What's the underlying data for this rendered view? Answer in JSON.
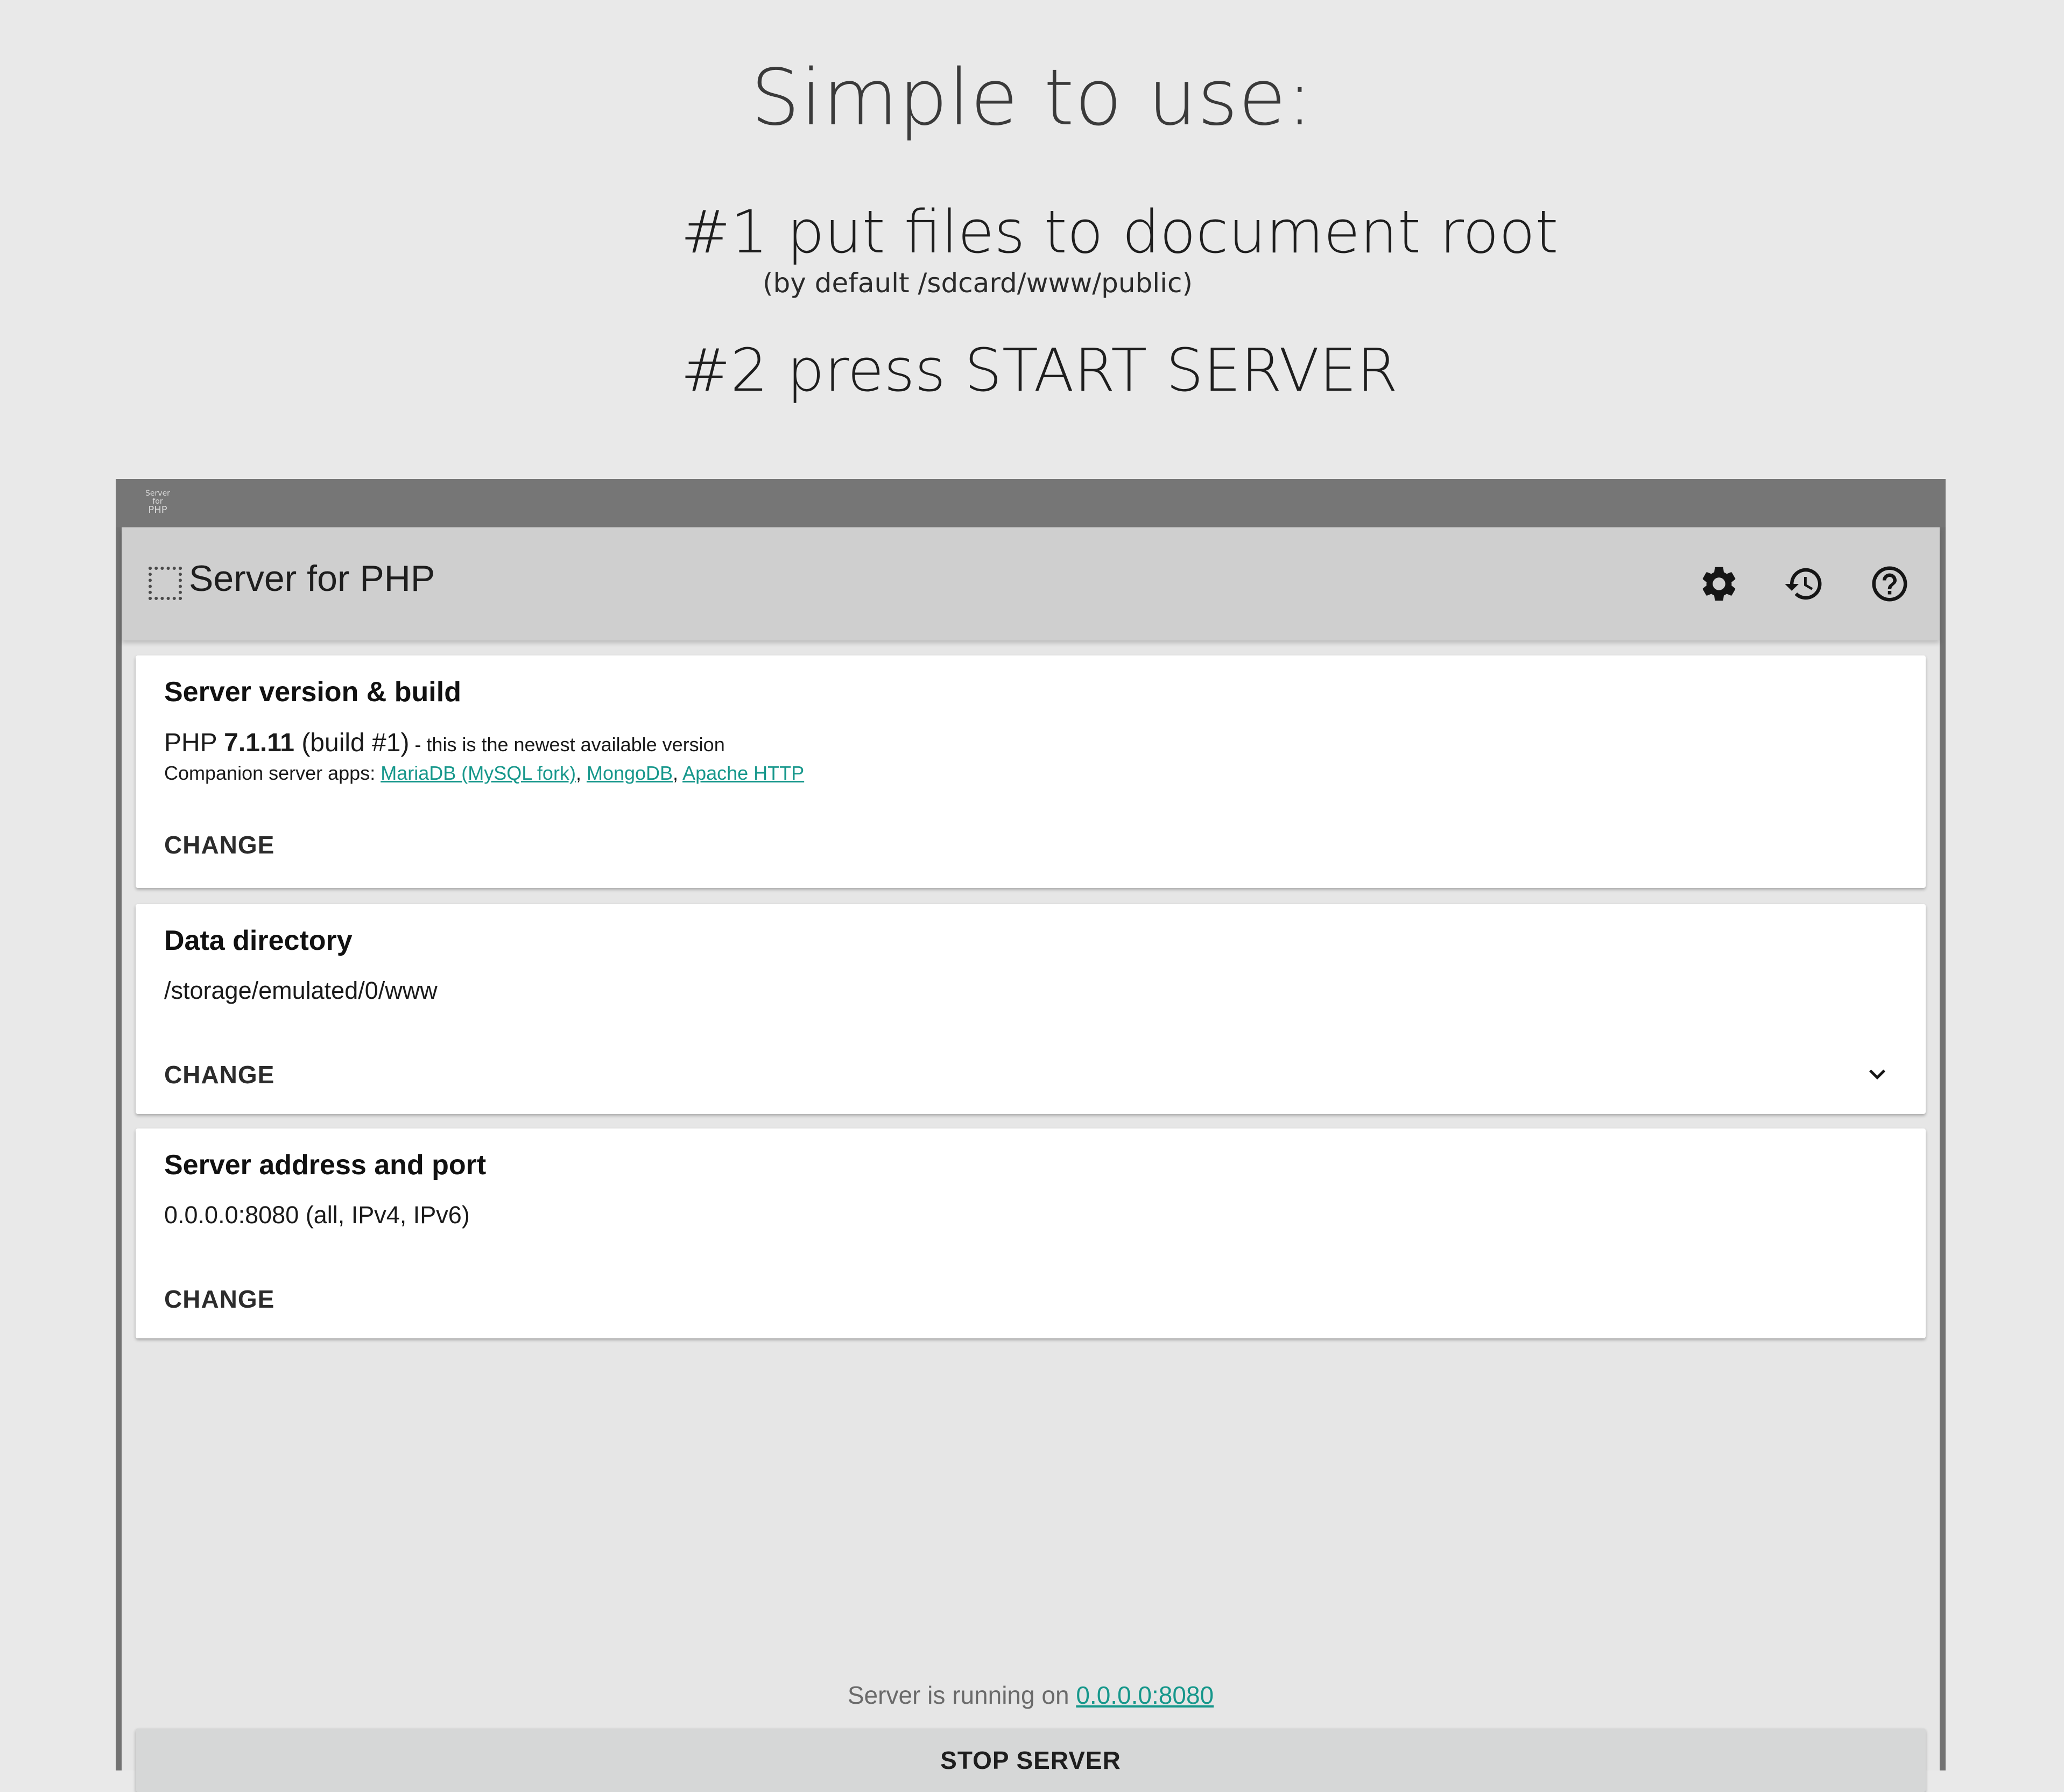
{
  "promo": {
    "title": "Simple to use:",
    "step1": "#1 put files to document root",
    "step1_sub": "(by default /sdcard/www/public)",
    "step2": "#2 press START SERVER"
  },
  "status_bar": {
    "logo_line1": "Server",
    "logo_line2": "for",
    "logo_line3": "PHP"
  },
  "toolbar": {
    "title": "Server for PHP",
    "icons": [
      "gear-icon",
      "history-icon",
      "help-icon"
    ]
  },
  "cards": {
    "version": {
      "title": "Server version & build",
      "php_prefix": "PHP ",
      "php_version": "7.1.11",
      "build": " (build #1)",
      "note": " - this is the newest available version",
      "companion_label": "Companion server apps: ",
      "companion_apps": [
        "MariaDB (MySQL fork)",
        "MongoDB",
        "Apache HTTP"
      ],
      "separator": ", ",
      "action": "CHANGE"
    },
    "data_dir": {
      "title": "Data directory",
      "value": "/storage/emulated/0/www",
      "action": "CHANGE"
    },
    "address": {
      "title": "Server address and port",
      "value": "0.0.0.0:8080 (all, IPv4, IPv6)",
      "action": "CHANGE"
    }
  },
  "footer": {
    "running_text": "Server is running on ",
    "running_link": "0.0.0.0:8080",
    "stop_label": "STOP SERVER"
  },
  "colors": {
    "link": "#16978b",
    "toolbar": "#cfcfcf",
    "background": "#e9e9e9"
  }
}
